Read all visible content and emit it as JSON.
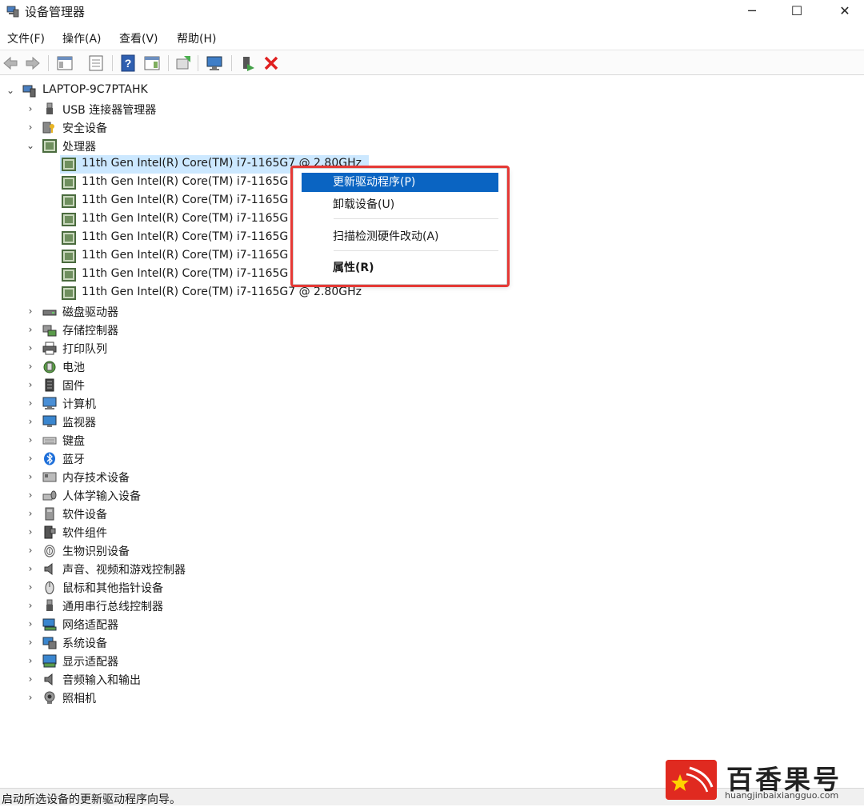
{
  "window": {
    "title": "设备管理器",
    "controls": {
      "minimize": "─",
      "maximize": "☐",
      "close": "✕"
    }
  },
  "menu": [
    "文件(F)",
    "操作(A)",
    "查看(V)",
    "帮助(H)"
  ],
  "toolbar_icons": [
    "back-arrow-icon",
    "forward-arrow-icon",
    "show-hide-console-tree-icon",
    "properties-sheet-icon",
    "help-icon",
    "action-pane-icon",
    "update-driver-icon",
    "scan-hardware-icon",
    "enable-device-icon",
    "uninstall-device-icon"
  ],
  "tree": {
    "root": "LAPTOP-9C7PTAHK",
    "categories_before": [
      {
        "label": "USB 连接器管理器",
        "icon": "usb-icon"
      },
      {
        "label": "安全设备",
        "icon": "security-key-icon"
      }
    ],
    "processor_category": "处理器",
    "processors": [
      "11th Gen Intel(R) Core(TM) i7-1165G7 @ 2.80GHz",
      "11th Gen Intel(R) Core(TM) i7-1165G",
      "11th Gen Intel(R) Core(TM) i7-1165G",
      "11th Gen Intel(R) Core(TM) i7-1165G",
      "11th Gen Intel(R) Core(TM) i7-1165G",
      "11th Gen Intel(R) Core(TM) i7-1165G",
      "11th Gen Intel(R) Core(TM) i7-1165G",
      "11th Gen Intel(R) Core(TM) i7-1165G7 @ 2.80GHz"
    ],
    "categories_after": [
      {
        "label": "磁盘驱动器",
        "icon": "disk-drive-icon"
      },
      {
        "label": "存储控制器",
        "icon": "storage-controller-icon"
      },
      {
        "label": "打印队列",
        "icon": "printer-icon"
      },
      {
        "label": "电池",
        "icon": "battery-icon"
      },
      {
        "label": "固件",
        "icon": "firmware-icon"
      },
      {
        "label": "计算机",
        "icon": "computer-icon"
      },
      {
        "label": "监视器",
        "icon": "monitor-icon"
      },
      {
        "label": "键盘",
        "icon": "keyboard-icon"
      },
      {
        "label": "蓝牙",
        "icon": "bluetooth-icon"
      },
      {
        "label": "内存技术设备",
        "icon": "memory-device-icon"
      },
      {
        "label": "人体学输入设备",
        "icon": "hid-icon"
      },
      {
        "label": "软件设备",
        "icon": "software-device-icon"
      },
      {
        "label": "软件组件",
        "icon": "software-component-icon"
      },
      {
        "label": "生物识别设备",
        "icon": "fingerprint-icon"
      },
      {
        "label": "声音、视频和游戏控制器",
        "icon": "speaker-icon"
      },
      {
        "label": "鼠标和其他指针设备",
        "icon": "mouse-icon"
      },
      {
        "label": "通用串行总线控制器",
        "icon": "usb-controller-icon"
      },
      {
        "label": "网络适配器",
        "icon": "network-adapter-icon"
      },
      {
        "label": "系统设备",
        "icon": "system-device-icon"
      },
      {
        "label": "显示适配器",
        "icon": "display-adapter-icon"
      },
      {
        "label": "音频输入和输出",
        "icon": "audio-io-icon"
      },
      {
        "label": "照相机",
        "icon": "camera-icon"
      }
    ]
  },
  "context_menu": {
    "update_driver": "更新驱动程序(P)",
    "uninstall": "卸载设备(U)",
    "scan": "扫描检测硬件改动(A)",
    "properties": "属性(R)"
  },
  "status": "启动所选设备的更新驱动程序向导。",
  "watermark": {
    "brand": "百香果号",
    "url": "huangjinbaixiangguo.com"
  },
  "colors": {
    "selection": "#cce8ff",
    "menu_active": "#0a64c2",
    "annotation_red": "#e53935"
  }
}
